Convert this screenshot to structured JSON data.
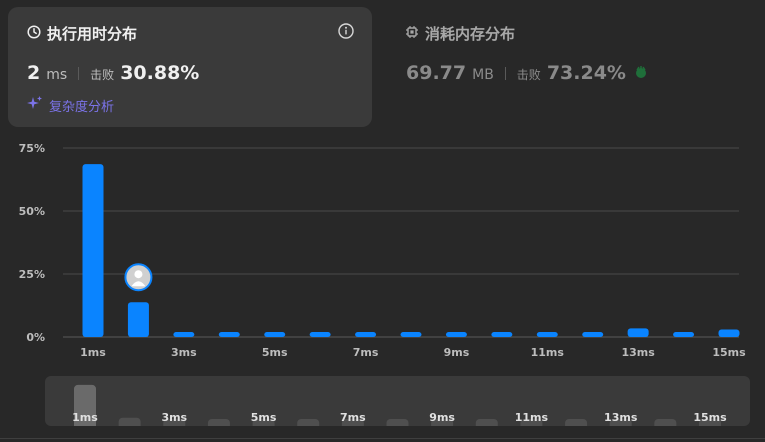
{
  "runtime": {
    "title": "执行用时分布",
    "value": "2",
    "unit": "ms",
    "beat_label": "击败",
    "beat_pct": "30.88%",
    "complexity_link": "复杂度分析",
    "icons": {
      "title": "clock-icon",
      "info": "info-icon",
      "link": "sparkle-icon"
    }
  },
  "memory": {
    "title": "消耗内存分布",
    "value": "69.77",
    "unit": "MB",
    "beat_label": "击败",
    "beat_pct": "73.24%",
    "icons": {
      "title": "chip-icon",
      "badge": "clap-icon"
    }
  },
  "colors": {
    "bar": "#0a84ff",
    "minimap_bar": "#4f4f4f",
    "minimap_bar_active": "#6a6a6a",
    "purple": "#7b73e8"
  },
  "chart_data": {
    "type": "bar",
    "categories": [
      "1ms",
      "2ms",
      "3ms",
      "4ms",
      "5ms",
      "6ms",
      "7ms",
      "8ms",
      "9ms",
      "10ms",
      "11ms",
      "12ms",
      "13ms",
      "14ms",
      "15ms"
    ],
    "x_tick_labels": [
      "1ms",
      "",
      "3ms",
      "",
      "5ms",
      "",
      "7ms",
      "",
      "9ms",
      "",
      "11ms",
      "",
      "13ms",
      "",
      "15ms"
    ],
    "values": [
      68.6,
      13.8,
      2.0,
      2.0,
      2.0,
      2.0,
      2.0,
      2.0,
      2.0,
      2.0,
      2.0,
      2.0,
      3.4,
      2.0,
      3.0
    ],
    "y_ticks": [
      "75%",
      "50%",
      "25%",
      "0%"
    ],
    "ylim": [
      0,
      75
    ],
    "grid": true,
    "marker": {
      "category": "2ms",
      "icon": "avatar"
    },
    "minimap": {
      "labels": [
        "1ms",
        "3ms",
        "5ms",
        "7ms",
        "9ms",
        "11ms",
        "13ms",
        "15ms"
      ],
      "highlighted_category": "1ms"
    }
  }
}
